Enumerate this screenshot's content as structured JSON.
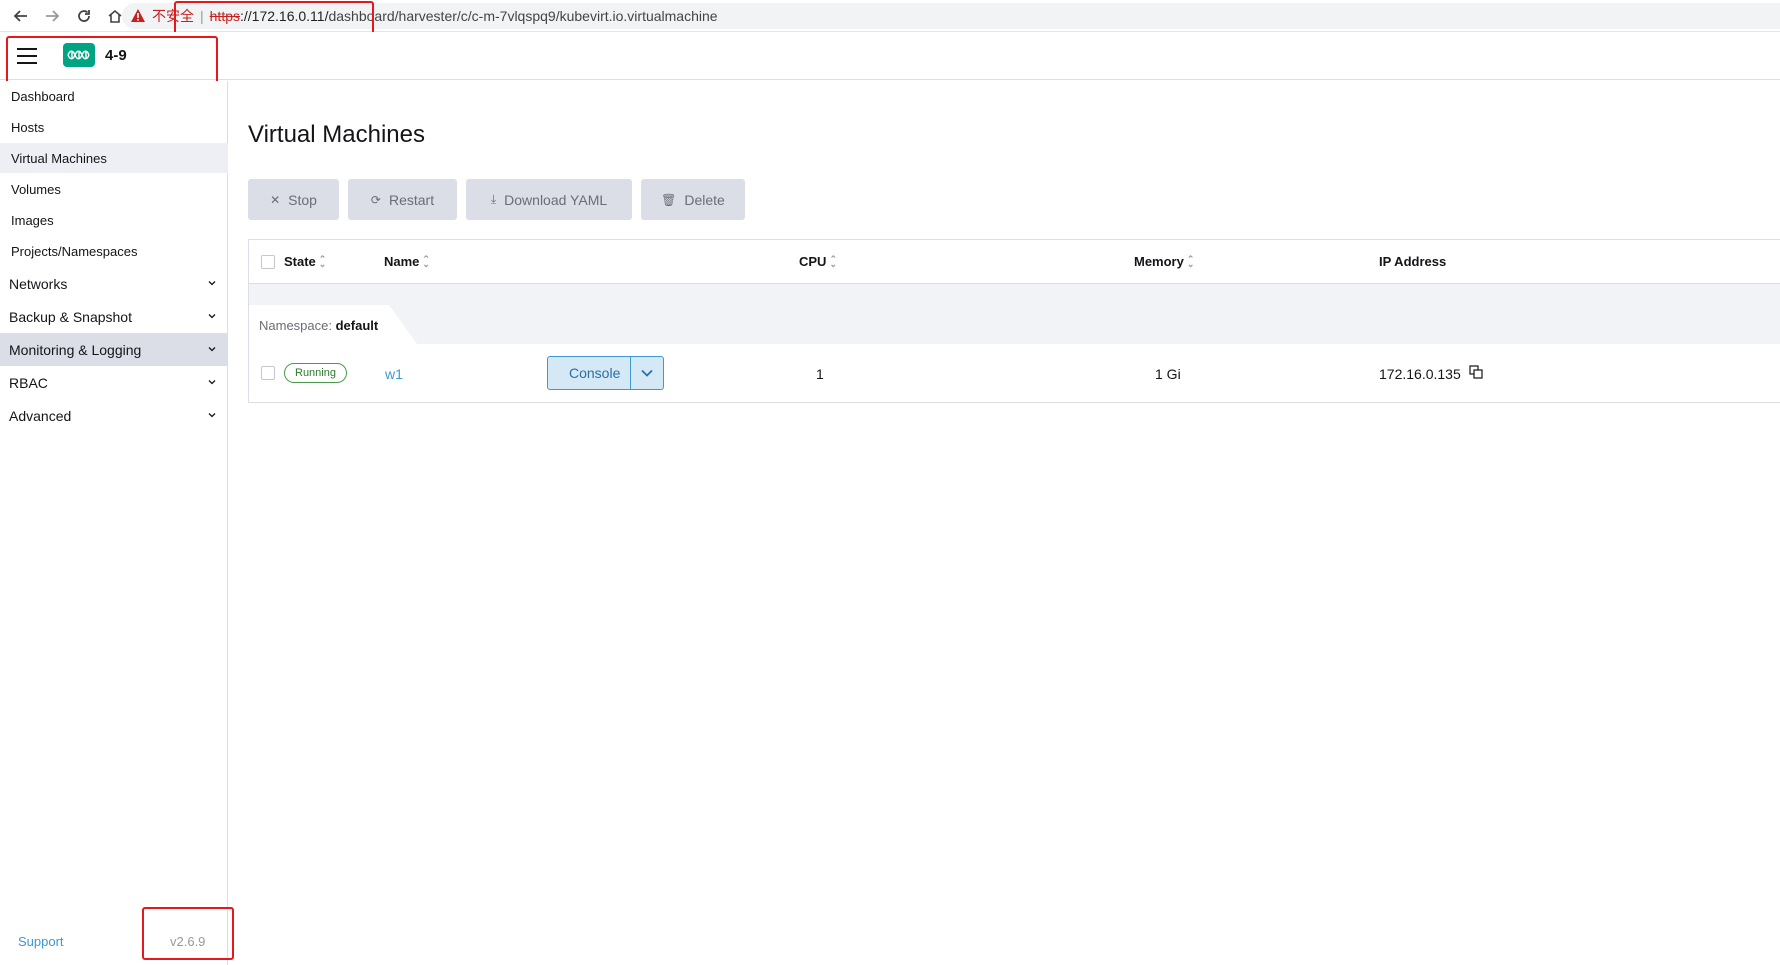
{
  "browser": {
    "insecure_label": "不安全",
    "separator": "|",
    "url_scheme": "https",
    "url_host": "://172.16.0.11/",
    "url_path": "dashboard/harvester/c/c-m-7vlqspq9/kubevirt.io.virtualmachine"
  },
  "header": {
    "cluster_name": "4-9"
  },
  "sidebar": {
    "items": [
      {
        "label": "Dashboard"
      },
      {
        "label": "Hosts"
      },
      {
        "label": "Virtual Machines"
      },
      {
        "label": "Volumes"
      },
      {
        "label": "Images"
      },
      {
        "label": "Projects/Namespaces"
      }
    ],
    "groups": [
      {
        "label": "Networks"
      },
      {
        "label": "Backup & Snapshot"
      },
      {
        "label": "Monitoring & Logging"
      },
      {
        "label": "RBAC"
      },
      {
        "label": "Advanced"
      }
    ],
    "active_item": "Virtual Machines",
    "active_group": "Monitoring & Logging",
    "support_label": "Support",
    "version": "v2.6.9"
  },
  "main": {
    "title": "Virtual Machines",
    "actions": {
      "stop": "Stop",
      "restart": "Restart",
      "download_yaml": "Download YAML",
      "delete": "Delete"
    },
    "table": {
      "columns": {
        "state": "State",
        "name": "Name",
        "cpu": "CPU",
        "memory": "Memory",
        "ip": "IP Address"
      },
      "group": {
        "prefix": "Namespace:",
        "name": "default"
      },
      "rows": [
        {
          "state": "Running",
          "name": "w1",
          "action": "Console",
          "cpu": "1",
          "memory": "1 Gi",
          "ip": "172.16.0.135"
        }
      ]
    }
  },
  "colors": {
    "accent": "#3d98d3",
    "brand": "#00a483",
    "warning": "#c5221f",
    "annotation": "#e8171b"
  }
}
